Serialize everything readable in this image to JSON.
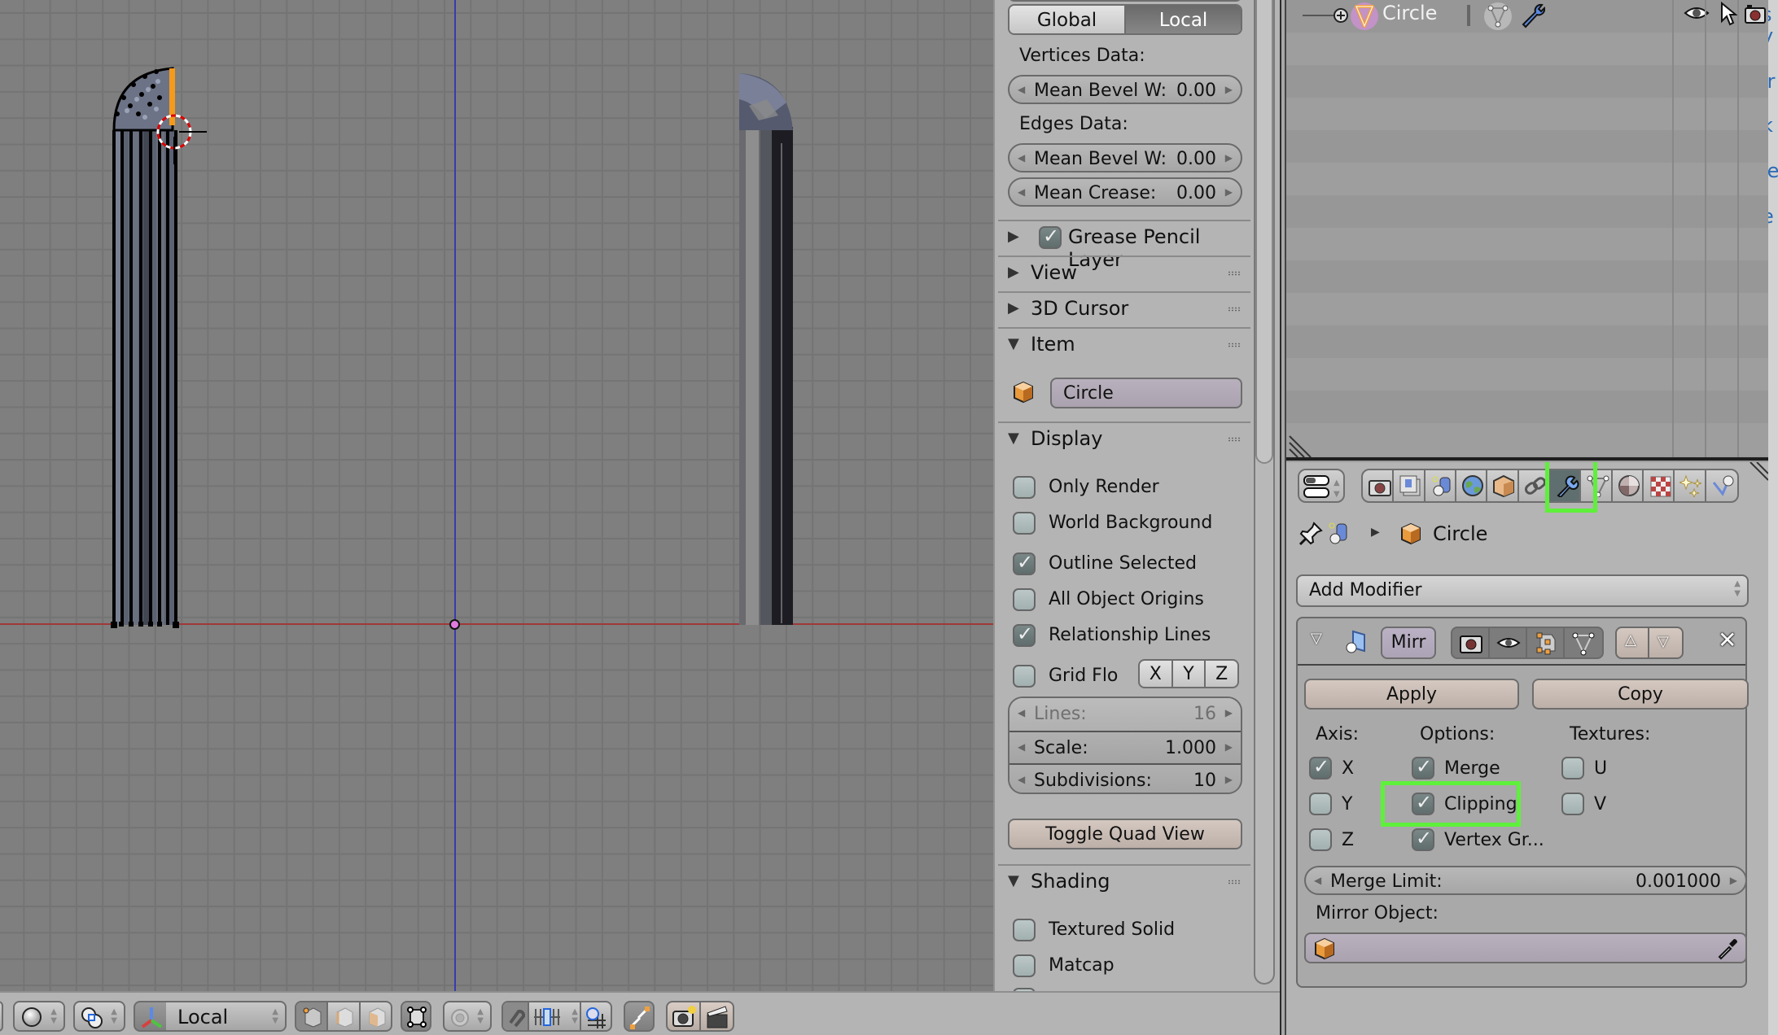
{
  "viewport": {
    "objects": [
      "Circle (edit mode, mirror half)",
      "Circle (mirrored result)"
    ]
  },
  "viewport_header": {
    "viewport_shading": "solid-sphere-icon",
    "pivot": "pivot-individual-origins-icon",
    "transform_orientation": "Local",
    "select_modes": [
      "vertex",
      "edge",
      "face"
    ],
    "proportional_editing": "off"
  },
  "npanel": {
    "transform_space": {
      "options": [
        "Global",
        "Local"
      ],
      "selected": "Local"
    },
    "vertices_data_label": "Vertices Data:",
    "vertices_mean_bevel": {
      "label": "Mean Bevel W:",
      "value": "0.00"
    },
    "edges_data_label": "Edges Data:",
    "edges_mean_bevel": {
      "label": "Mean Bevel W:",
      "value": "0.00"
    },
    "edges_mean_crease": {
      "label": "Mean Crease:",
      "value": "0.00"
    },
    "panels": {
      "grease_pencil": {
        "label": "Grease Pencil Layer",
        "expanded": false,
        "enabled": true
      },
      "view": {
        "label": "View",
        "expanded": false
      },
      "cursor": {
        "label": "3D Cursor",
        "expanded": false
      },
      "item": {
        "label": "Item",
        "expanded": true,
        "name": "Circle"
      },
      "display": {
        "label": "Display",
        "expanded": true,
        "options": [
          {
            "label": "Only Render",
            "checked": false
          },
          {
            "label": "World Background",
            "checked": false
          },
          {
            "label": "Outline Selected",
            "checked": true
          },
          {
            "label": "All Object Origins",
            "checked": false
          },
          {
            "label": "Relationship Lines",
            "checked": true
          }
        ],
        "grid_floor": {
          "label": "Grid Flo",
          "checked": false,
          "axes": [
            "X",
            "Y",
            "Z"
          ]
        },
        "lines": {
          "label": "Lines:",
          "value": "16"
        },
        "scale": {
          "label": "Scale:",
          "value": "1.000"
        },
        "subdivisions": {
          "label": "Subdivisions:",
          "value": "10"
        },
        "toggle_quad": "Toggle Quad View"
      },
      "shading": {
        "label": "Shading",
        "expanded": true,
        "options": [
          {
            "label": "Textured Solid",
            "checked": false
          },
          {
            "label": "Matcap",
            "checked": false
          }
        ]
      }
    }
  },
  "outliner": {
    "items": [
      {
        "name": "Circle",
        "type": "mesh",
        "modifiers": true
      }
    ],
    "column_icons": [
      "eye-icon",
      "cursor-icon",
      "camera-icon"
    ]
  },
  "properties": {
    "context_tabs": [
      "render",
      "render-layers",
      "scene",
      "world",
      "object",
      "constraints",
      "modifiers",
      "data",
      "material",
      "texture",
      "particles",
      "physics"
    ],
    "active_tab": "modifiers",
    "breadcrumb": {
      "object": "Circle"
    },
    "add_modifier": "Add Modifier",
    "modifier": {
      "name": "Mirr",
      "apply": "Apply",
      "copy": "Copy",
      "axis_label": "Axis:",
      "options_label": "Options:",
      "textures_label": "Textures:",
      "axis": [
        {
          "label": "X",
          "checked": true
        },
        {
          "label": "Y",
          "checked": false
        },
        {
          "label": "Z",
          "checked": false
        }
      ],
      "options": [
        {
          "label": "Merge",
          "checked": true
        },
        {
          "label": "Clipping",
          "checked": true
        },
        {
          "label": "Vertex Gr...",
          "checked": true
        }
      ],
      "textures": [
        {
          "label": "U",
          "checked": false
        },
        {
          "label": "V",
          "checked": false
        }
      ],
      "merge_limit": {
        "label": "Merge Limit:",
        "value": "0.001000"
      },
      "mirror_object_label": "Mirror Object:",
      "mirror_object_value": ""
    }
  },
  "highlights": {
    "color": "#5ef03a",
    "targets": [
      "modifiers-tab",
      "clipping-option"
    ]
  },
  "right_edge_clipped_text": [
    "s",
    "y",
    "ır",
    "k",
    "ıe",
    "e"
  ]
}
